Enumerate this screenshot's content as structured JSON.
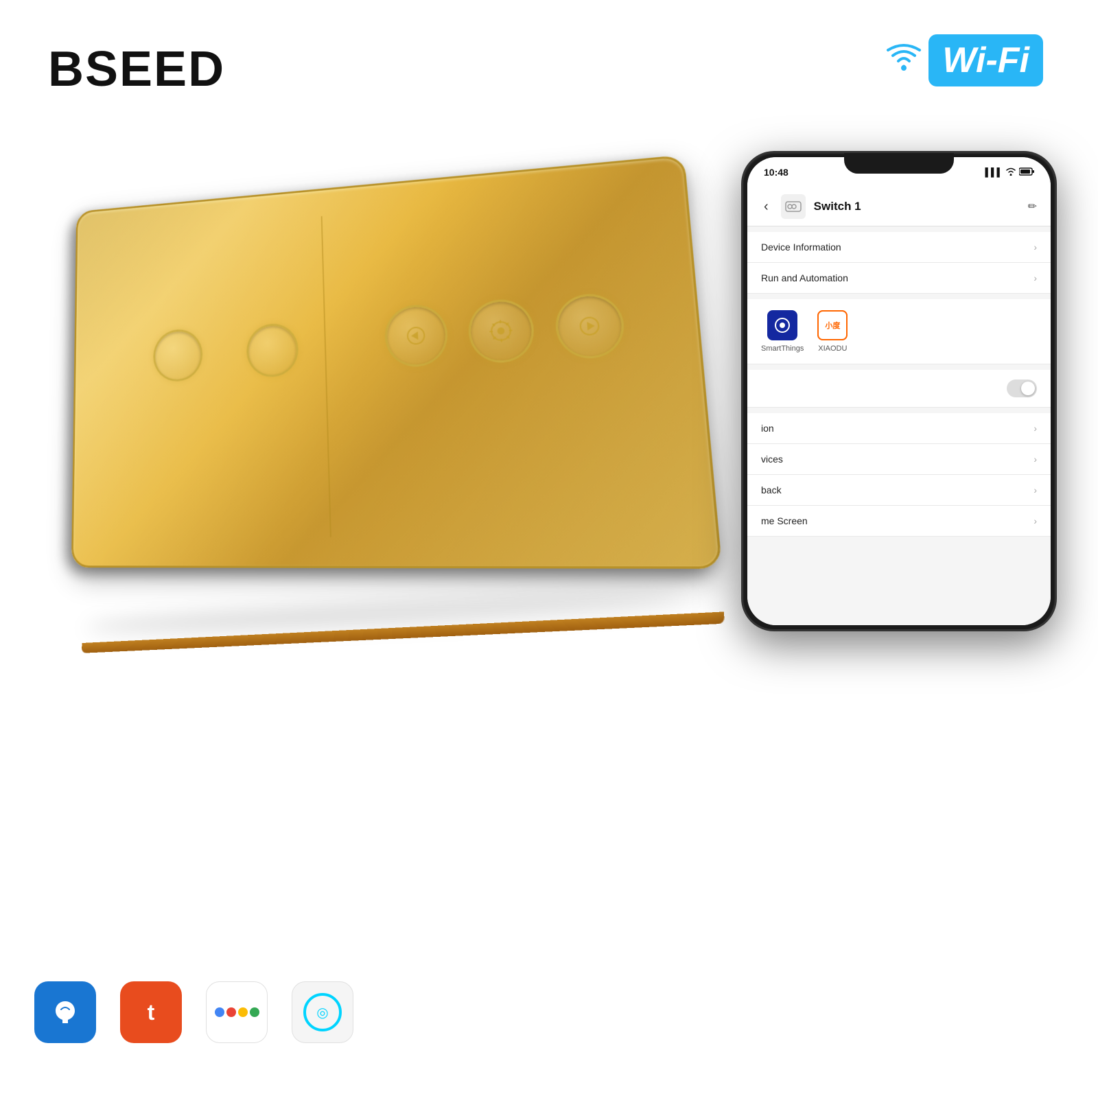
{
  "brand": {
    "name": "BSEED"
  },
  "wifi_badge": {
    "icon": "📶",
    "text": "Wi-Fi"
  },
  "switch": {
    "alt": "Golden touch light switch panel with 2 touch buttons and 3 dimmer controls"
  },
  "phone": {
    "status_bar": {
      "time": "10:48",
      "signal": "▌▌▌",
      "wifi": "▾",
      "battery": "▐"
    },
    "header": {
      "back": "‹",
      "device_name": "Switch 1",
      "edit_icon": "✏"
    },
    "menu_items": [
      {
        "label": "Device Information",
        "has_chevron": true
      },
      {
        "label": "Run and Automation",
        "has_chevron": true
      }
    ],
    "assistants": [
      {
        "name": "SmartThings",
        "icon": "ST"
      },
      {
        "name": "XIAODU",
        "icon": "小度"
      }
    ],
    "toggle_label": "",
    "lower_menu_items": [
      {
        "label": "ion",
        "has_chevron": true
      },
      {
        "label": "vices",
        "has_chevron": true
      },
      {
        "label": "back",
        "has_chevron": true
      },
      {
        "label": "me Screen",
        "has_chevron": true
      }
    ]
  },
  "app_icons": [
    {
      "name": "Smart Life",
      "type": "smart-life"
    },
    {
      "name": "Tuya",
      "type": "tuya"
    },
    {
      "name": "Google Assistant",
      "type": "google"
    },
    {
      "name": "Alexa",
      "type": "alexa"
    }
  ]
}
